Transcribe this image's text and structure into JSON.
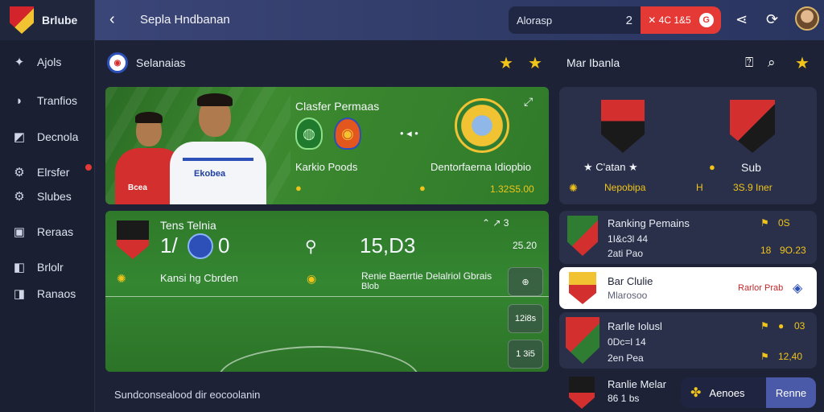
{
  "app": {
    "brand": "Brlube",
    "title": "Sepla Hndbanan"
  },
  "sidebar": {
    "items": [
      {
        "label": "Ajols",
        "icon": "soccer-ball-icon"
      },
      {
        "label": "Tranfios",
        "icon": "whistle-icon"
      },
      {
        "label": "Decnola",
        "icon": "board-icon"
      },
      {
        "label": "Elrsfer",
        "icon": "gear-icon"
      },
      {
        "label": "Slubes",
        "icon": "gear-icon"
      },
      {
        "label": "Reraas",
        "icon": "folder-icon"
      },
      {
        "label": "Brlolr",
        "icon": "stack-icon"
      },
      {
        "label": "Ranaos",
        "icon": "stack-icon"
      }
    ]
  },
  "topbar": {
    "search_placeholder": "Alorasp",
    "search_count": "2",
    "live_label": "✕ 4C 1&5",
    "live_icon_text": "G"
  },
  "left_section": {
    "title": "Selanaias"
  },
  "hero": {
    "heading": "Clasfer Permaas",
    "left_caption": "Karkio Poods",
    "right_caption": "Dentorfaerna Idiopbio",
    "dots": "• ◂ •",
    "value": "1.32S5.00",
    "jersey_text": "Ekobea",
    "jersey_text2": "Bcea"
  },
  "match": {
    "team_label": "Tens Telnia",
    "score_left": "1/",
    "score_right": "0",
    "time": "15,D3",
    "time_small": "25.20",
    "top_right": "⌃ ↗ 3",
    "venue": "Kansi hg Cbrden",
    "info_line1": "Renie Baerrtie Delalriol Gbrais",
    "info_line2": "Blob",
    "chips": [
      "⊕",
      "12i8s",
      "1 3i5"
    ]
  },
  "footer_note": "Sundconsealood dir eocoolanin",
  "right_section": {
    "title": "Mar Ibanla"
  },
  "teams_card": {
    "left_label": "★ C'atan ★",
    "right_label": "Sub",
    "left_sub": "Nepobipa",
    "right_sub": "3S.9 Iner",
    "mid_sub": "H"
  },
  "ranking": [
    {
      "title": "Ranking Pemains",
      "line2": "1I&c3l 44",
      "line3": "2ati Pao",
      "stat1": "0S",
      "stat2": "9O.23",
      "icon_left": "⚑",
      "prefix": "18"
    },
    {
      "title": "Bar Clulie",
      "line2": "Mlarosoo",
      "line3": "",
      "stat1": "Rarlor Prab",
      "stat2": "",
      "icon_left": "⚑",
      "prefix": ""
    },
    {
      "title": "Rarlle Iolusl",
      "line2": "0Dc=l 14",
      "line3": "2en Pea",
      "stat1": "03",
      "stat2": "12,40",
      "icon_left": "⚑",
      "prefix": ""
    },
    {
      "title": "Ranlie Melar",
      "line2": "86 1 bs",
      "line3": "",
      "stat1": "",
      "stat2": "",
      "icon_left": "⚑",
      "prefix": ""
    }
  ],
  "bottom_pill": {
    "left_label": "Aenoes",
    "right_label": "Renne"
  },
  "colors": {
    "accent": "#e53935",
    "gold": "#f0c419",
    "pitch": "#348631",
    "panel": "#2a3049"
  }
}
